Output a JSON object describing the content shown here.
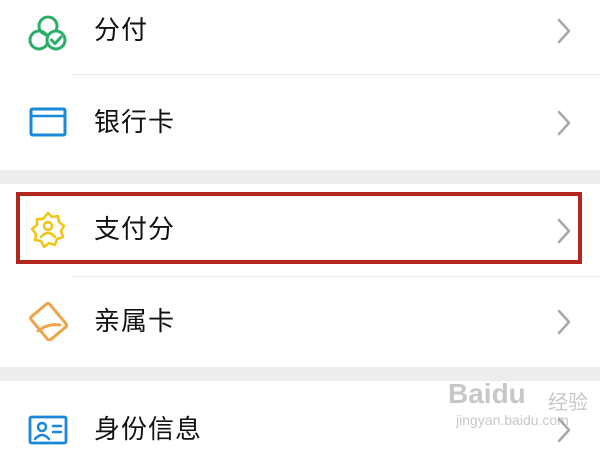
{
  "menu": {
    "items": [
      {
        "label": "分付",
        "icon": "fenfu-clover-check-icon",
        "icon_color": "#2aae67"
      },
      {
        "label": "银行卡",
        "icon": "bank-card-icon",
        "icon_color": "#1a87d9"
      },
      {
        "label": "支付分",
        "icon": "payscore-badge-icon",
        "icon_color": "#f1c40f"
      },
      {
        "label": "亲属卡",
        "icon": "family-card-icon",
        "icon_color": "#f0a44a"
      },
      {
        "label": "身份信息",
        "icon": "id-card-icon",
        "icon_color": "#1a87d9"
      }
    ],
    "highlighted_item": "支付分",
    "highlight_color": "#b3261e"
  },
  "watermark": {
    "brand": "Baidu",
    "brand_cn": "经验",
    "url": "jingyan.baidu.com"
  }
}
